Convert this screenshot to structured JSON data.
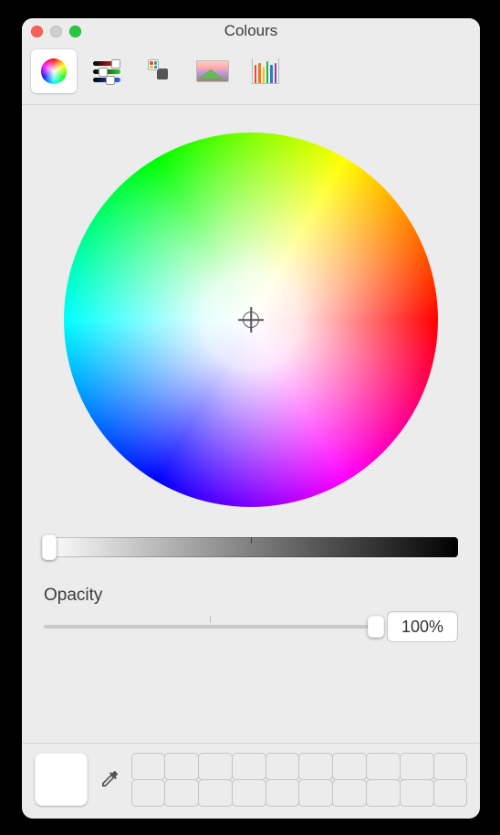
{
  "window": {
    "title": "Colours"
  },
  "toolbar": {
    "tabs": [
      {
        "name": "colour-wheel-tab",
        "icon": "wheel-icon",
        "selected": true
      },
      {
        "name": "colour-sliders-tab",
        "icon": "sliders-icon",
        "selected": false
      },
      {
        "name": "colour-palettes-tab",
        "icon": "palette-icon",
        "selected": false
      },
      {
        "name": "image-palettes-tab",
        "icon": "image-icon",
        "selected": false
      },
      {
        "name": "pencils-tab",
        "icon": "pencils-icon",
        "selected": false
      }
    ]
  },
  "picker": {
    "mode": "wheel",
    "brightness_percent": 100
  },
  "opacity": {
    "label": "Opacity",
    "value_text": "100%",
    "percent": 100
  },
  "footer": {
    "current_color": "#ffffff",
    "eyedropper_name": "eyedropper-icon",
    "swatch_count": 20
  }
}
